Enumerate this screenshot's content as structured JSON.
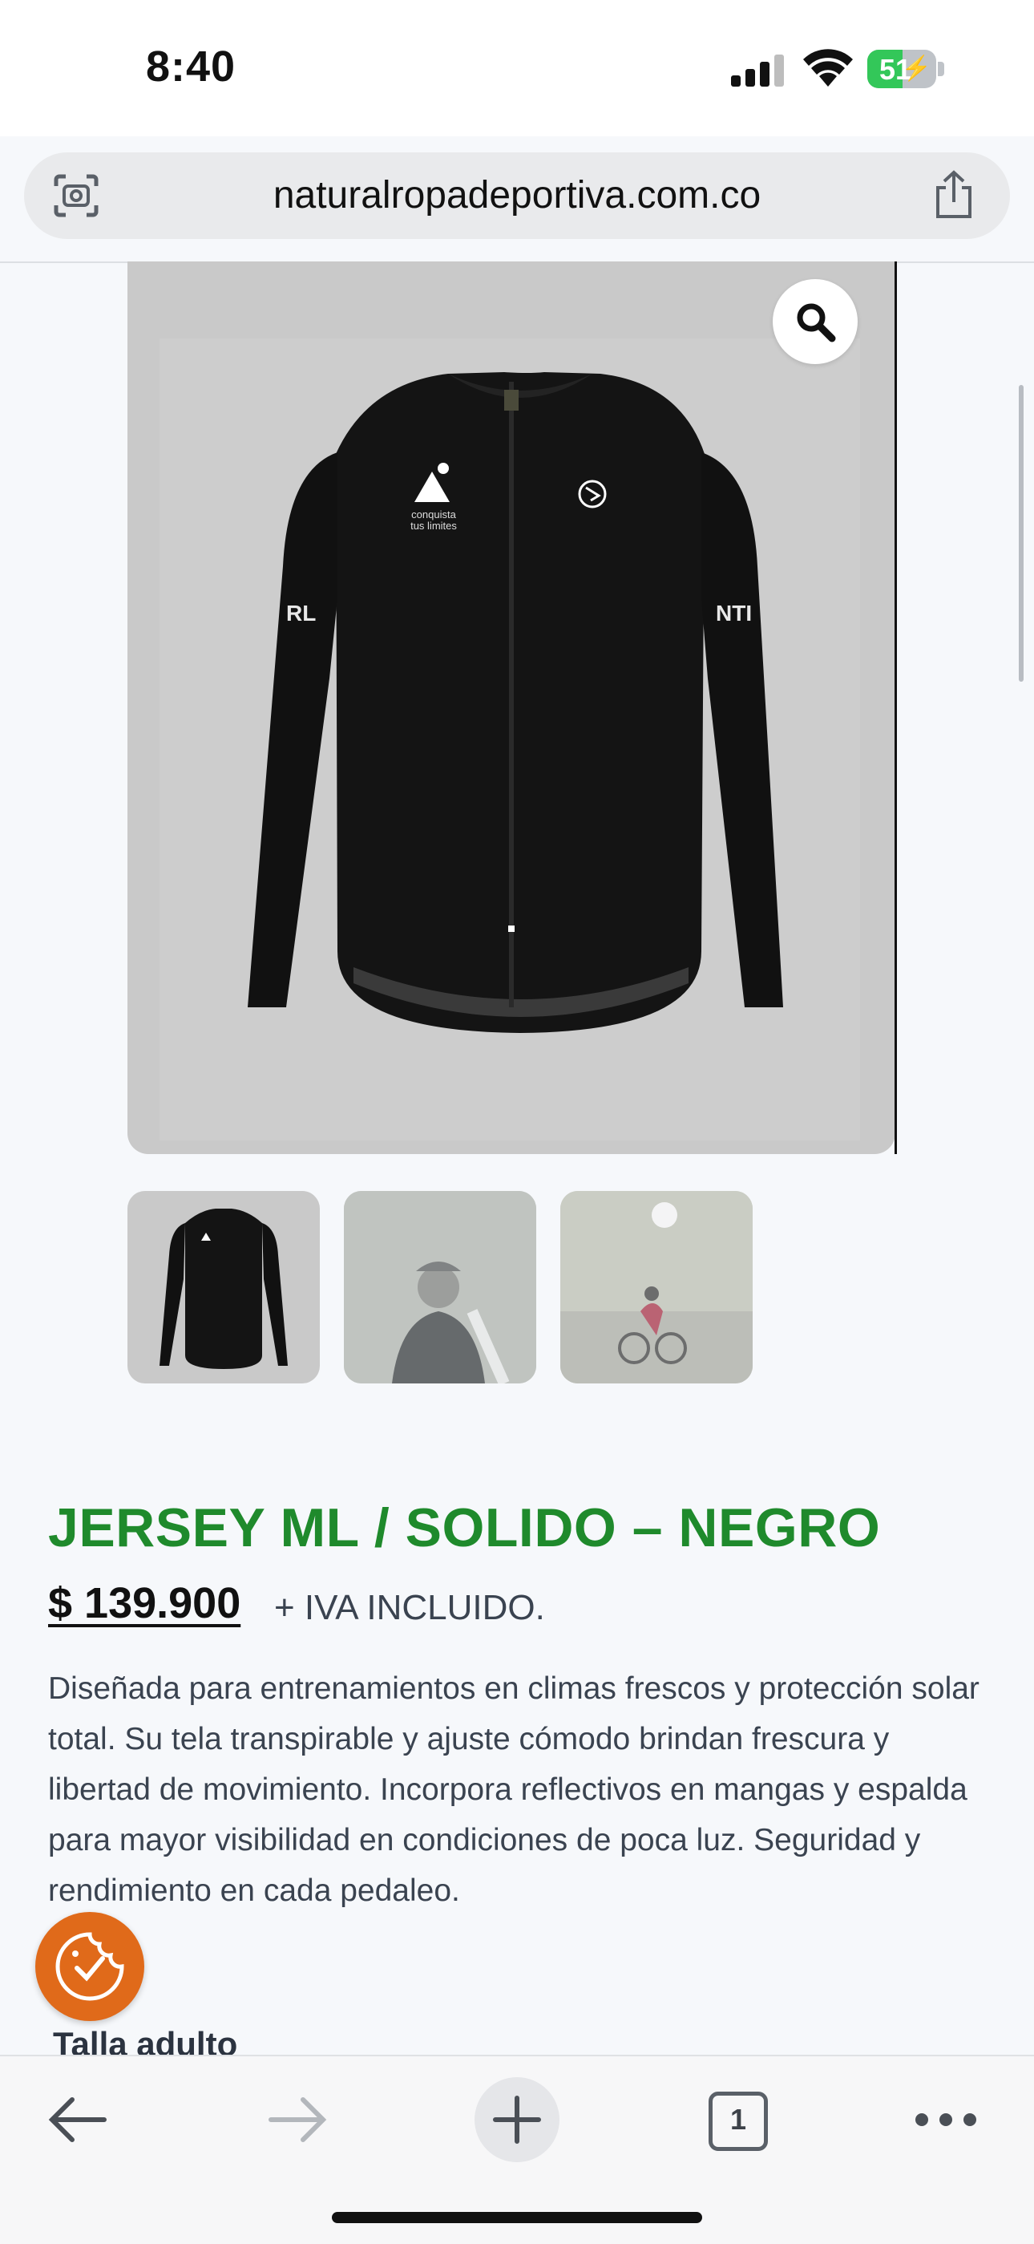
{
  "status_bar": {
    "time": "8:40",
    "battery_level": "51",
    "battery_fraction": 0.51,
    "charging": true
  },
  "browser": {
    "url": "naturalropadeportiva.com.co",
    "tab_count": "1"
  },
  "product": {
    "title": "JERSEY ML / SOLIDO – NEGRO",
    "price": "$ 139.900",
    "tax_note": "+ IVA INCLUIDO.",
    "description": "Diseñada para entrenamientos en climas frescos y protección solar total. Su tela transpirable y ajuste cómodo brindan frescura y libertad de movimiento. Incorpora reflectivos en mangas y espalda para mayor visibilidad en condiciones de poca luz. Seguridad y rendimiento en cada pedaleo.",
    "size_label": "Talla adulto"
  },
  "jersey_print": {
    "chest_logo_line1": "conquista",
    "chest_logo_line2": "tus limites",
    "sleeve_left": "RL",
    "sleeve_right": "NTI"
  },
  "colors": {
    "title_green": "#1f8a2c",
    "cookie_orange": "#e06a1a",
    "battery_green": "#33c759"
  },
  "icons": [
    "lens-icon",
    "share-icon",
    "zoom-icon",
    "cookie-icon",
    "back-icon",
    "forward-icon",
    "plus-icon",
    "tabs-icon",
    "more-icon"
  ]
}
